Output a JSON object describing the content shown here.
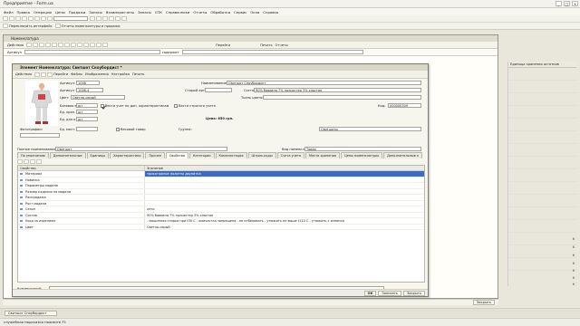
{
  "window": {
    "title": "Предприятие - Form.ua",
    "controls": [
      "_",
      "□",
      "×"
    ]
  },
  "menu": [
    "Файл",
    "Правка",
    "Операции",
    "Цены",
    "Продажи",
    "Запасы",
    "Взаиморасчеты",
    "Запасы",
    "СПК",
    "Справочники",
    "Отчеты",
    "Обработки",
    "Сервис",
    "Окна",
    "Справка"
  ],
  "toolbar2": {
    "items": [
      "Переключить интерфейс",
      "Отчеты номенклатуры и продажи"
    ]
  },
  "list_window": {
    "title": "Номенклатура",
    "actions_label": "Действия",
    "goto_label": "Перейти",
    "print_label": "Печать",
    "reports_label": "Отчеты",
    "filter_label": "Артикул",
    "filter_mode": "содержит",
    "right_header": "Единица хранения остатков",
    "right_marks": [
      "6",
      "6",
      "6",
      "6",
      "6",
      "6",
      "6",
      "6"
    ],
    "bottom_buttons": [
      "Закрыть"
    ]
  },
  "element_form": {
    "title": "Элемент Номенклатура: Свитшот Сноубордист *",
    "toolbar": {
      "actions": "Действия",
      "goto": "Перейти",
      "files": "Файлы",
      "images": "Изображения",
      "settings": "Настройка",
      "print": "Печать"
    },
    "fields": {
      "article_label": "Артикул:",
      "article": "1046",
      "name_label": "Наименование:",
      "name": "Свитшот Сноубордист",
      "article_price_label": "Артикул + цвет:",
      "article_price": "1046-4",
      "old_article_label": "Старый артикул:",
      "old_article": "",
      "composition_label": "Состав:",
      "composition": "90% бавовна 7% полиэстер 3% эластан",
      "color_label": "Цвет:",
      "color": "Светло-серый",
      "fabric_color_label": "Ткань цвета:",
      "fabric_color": "",
      "base_unit_label": "Базовая ед.:",
      "base_unit": "шт",
      "weight_chars_label": "Вести учет по доп. характеристикам",
      "strict_label": "Вести строгого учета",
      "code_label": "Код:",
      "code": "000000309",
      "storage_unit_label": "Ед. хран. ост.:",
      "storage_unit": "шт",
      "report_unit_label": "Ед. для отчетов:",
      "report_unit": "шт",
      "price_label": "Цена: 650 грн.",
      "photos_label": "Фотографии:",
      "places_label": "Ед. мест:",
      "places": "",
      "weight_label": "Весовой товар",
      "group_label": "Группа:",
      "group": "Свитшоты",
      "full_name_label": "Полное наименование:",
      "full_name": "Свитшот",
      "type_label": "Вид номенклатуры:",
      "type": "Товар"
    },
    "tabs": [
      "По умолчанию",
      "Дополнительные",
      "Единицы",
      "Характеристики",
      "Прочее",
      "Свойства",
      "Категории",
      "Комплектация",
      "Штрих-коды",
      "Счета учета",
      "Места хранения",
      "Цены номенклатуры",
      "Дополнительные к"
    ],
    "props_header": [
      "Свойство",
      "Значение"
    ],
    "props": [
      {
        "name": "Материал",
        "value": "трикотажное полотно двунитка",
        "selected": true
      },
      {
        "name": "Новинка",
        "value": ""
      },
      {
        "name": "Параметры модели",
        "value": ""
      },
      {
        "name": "Размер изделия на модели",
        "value": ""
      },
      {
        "name": "Распродажа",
        "value": ""
      },
      {
        "name": "Рост модели",
        "value": ""
      },
      {
        "name": "Сезон",
        "value": "лето"
      },
      {
        "name": "Состав",
        "value": "90% бавовна 7% полиэстер 3% эластан"
      },
      {
        "name": "Уход за изделием",
        "value": "- машинная стирка при t30 С - химчистка запрещена - не отбеливать - утюжить не выше t110 С - утюжить с изнанки"
      },
      {
        "name": "Цвет",
        "value": "Светло-серый"
      }
    ],
    "comment_label": "Комментарий:",
    "bottom_buttons": [
      "OK",
      "Записать",
      "Закрыть"
    ]
  },
  "taskbar": {
    "item": "Свитшот Сноубордист"
  },
  "status": {
    "text": "служебная подсказка нажмите F1"
  }
}
